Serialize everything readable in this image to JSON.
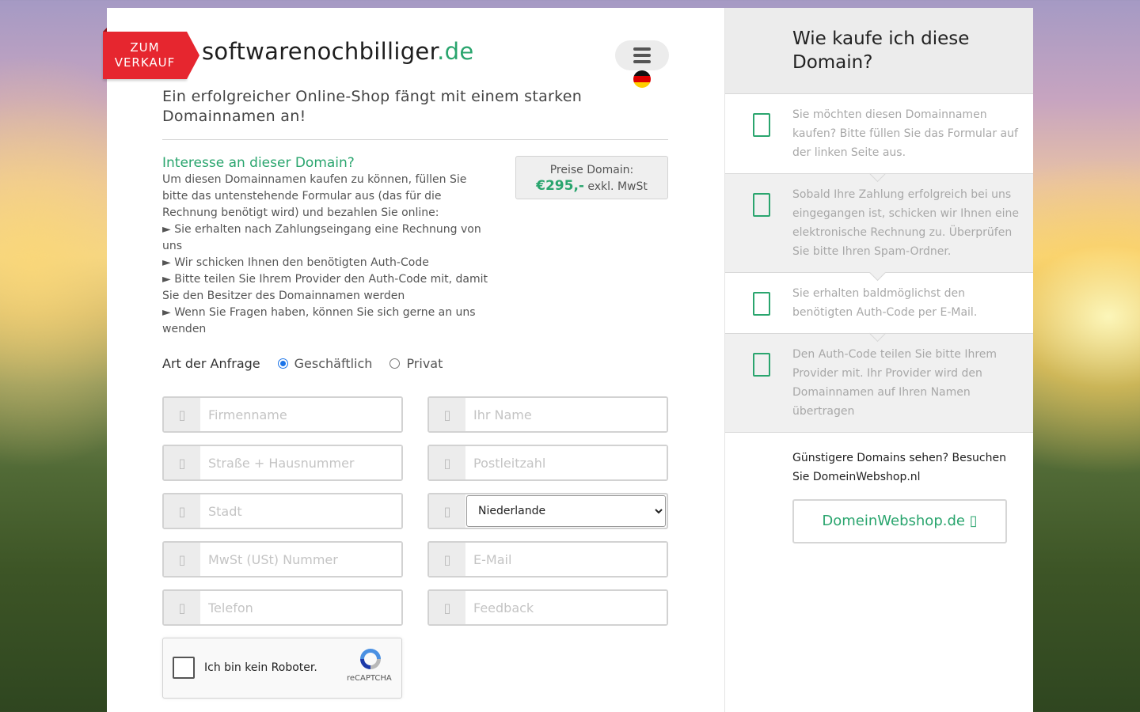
{
  "ribbon": {
    "line1": "ZUM",
    "line2": "VERKAUF"
  },
  "site": {
    "name": "softwarenochbilliger",
    "tld": ".de"
  },
  "tagline": "Ein erfolgreicher Online-Shop fängt mit einem starken Domainnamen an!",
  "interest": {
    "title": "Interesse an dieser Domain?",
    "intro": "Um diesen Domainnamen kaufen zu können, füllen Sie bitte das untenstehende Formular aus (das für die Rechnung benötigt wird) und bezahlen Sie online:",
    "bullets": [
      "► Sie erhalten nach Zahlungseingang eine Rechnung von uns",
      "► Wir schicken Ihnen den benötigten Auth-Code",
      "► Bitte teilen Sie Ihrem Provider den Auth-Code mit, damit Sie den Besitzer des Domainnamen werden",
      "► Wenn Sie Fragen haben, können Sie sich gerne an uns wenden"
    ]
  },
  "price": {
    "label": "Preise Domain:",
    "amount": "€295,-",
    "suffix": "exkl. MwSt"
  },
  "request": {
    "label": "Art der Anfrage",
    "option1": "Geschäftlich",
    "option2": "Privat",
    "selected": "Geschäftlich"
  },
  "form": {
    "company": "Firmenname",
    "name": "Ihr Name",
    "street": "Straße + Hausnummer",
    "zip": "Postleitzahl",
    "city": "Stadt",
    "country": "Niederlande",
    "vat": "MwSt (USt) Nummer",
    "email": "E-Mail",
    "phone": "Telefon",
    "feedback": "Feedback"
  },
  "captcha": {
    "label": "Ich bin kein Roboter.",
    "brand": "reCAPTCHA"
  },
  "right": {
    "title": "Wie kaufe ich diese Domain?",
    "steps": [
      "Sie möchten diesen Domainnamen kaufen? Bitte füllen Sie das Formular auf der linken Seite aus.",
      "Sobald Ihre Zahlung erfolgreich bei uns eingegangen ist, schicken wir Ihnen eine elektronische Rechnung zu. Überprüfen Sie bitte Ihren Spam-Ordner.",
      "Sie erhalten baldmöglichst den benötigten Auth-Code per E-Mail.",
      "Den Auth-Code teilen Sie bitte Ihrem Provider mit. Ihr Provider wird den Domainnamen auf Ihren Namen übertragen"
    ],
    "cheaper": "Günstigere Domains sehen? Besuchen Sie DomeinWebshop.nl",
    "button": "DomeinWebshop.de ▯"
  },
  "colors": {
    "accent": "#2aa56e",
    "ribbon": "#e6262f"
  }
}
